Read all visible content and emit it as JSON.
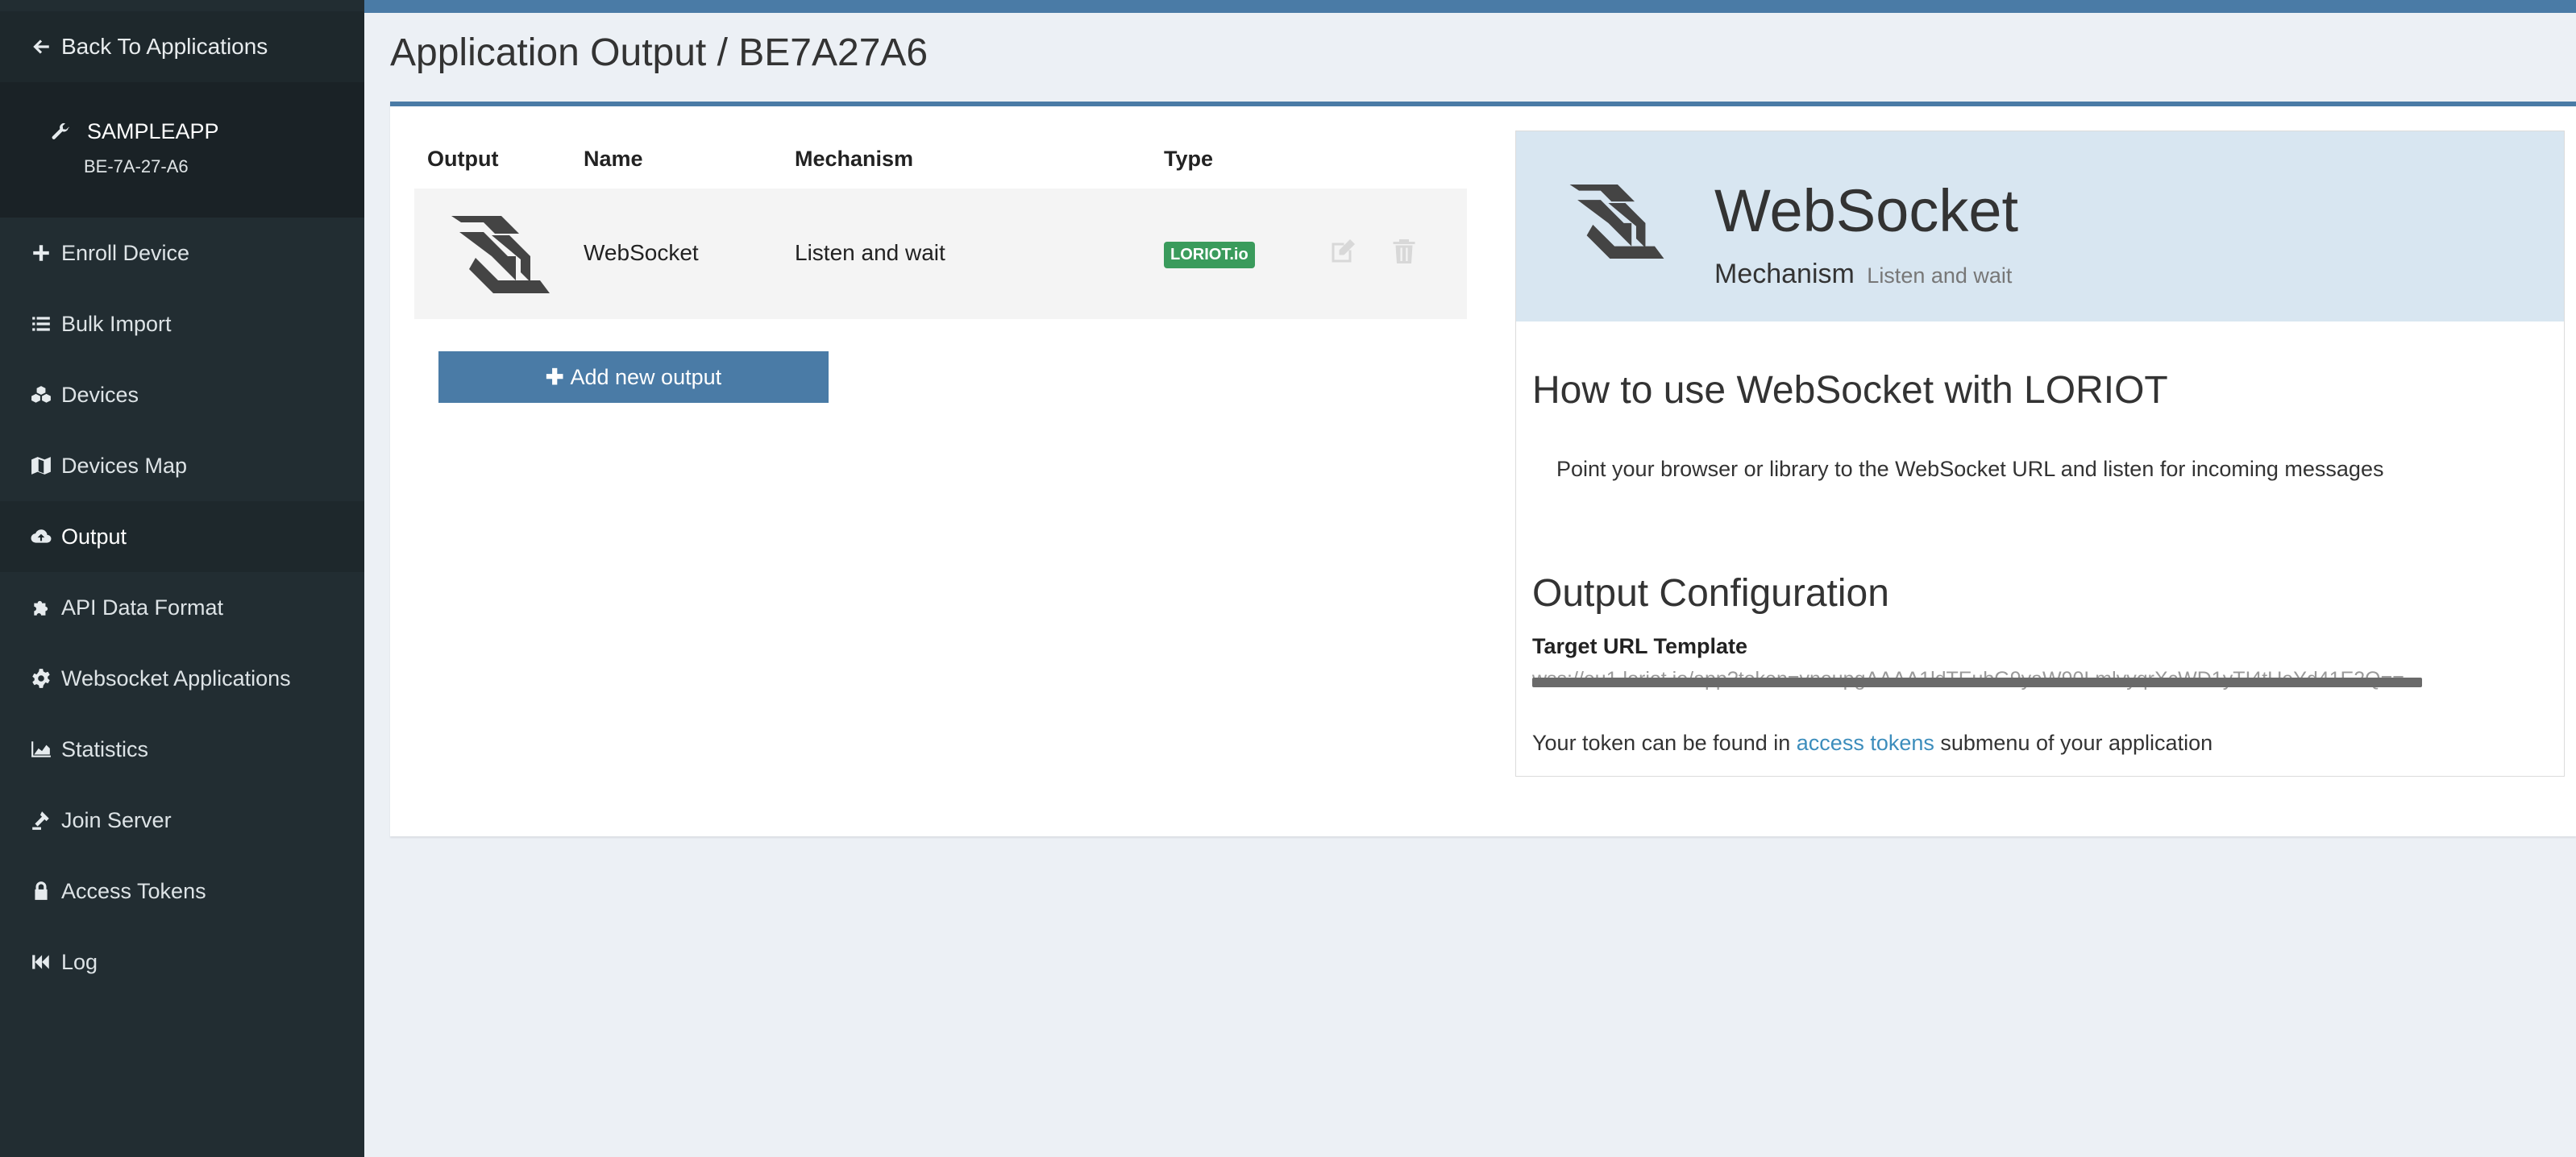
{
  "sidebar": {
    "back_label": "Back To Applications",
    "app_name": "SAMPLEAPP",
    "app_id": "BE-7A-27-A6",
    "items": [
      {
        "label": "Enroll Device",
        "icon": "plus-icon"
      },
      {
        "label": "Bulk Import",
        "icon": "list-icon"
      },
      {
        "label": "Devices",
        "icon": "cubes-icon"
      },
      {
        "label": "Devices Map",
        "icon": "map-icon"
      },
      {
        "label": "Output",
        "icon": "cloud-upload-icon"
      },
      {
        "label": "API Data Format",
        "icon": "puzzle-icon"
      },
      {
        "label": "Websocket Applications",
        "icon": "gear-icon"
      },
      {
        "label": "Statistics",
        "icon": "area-chart-icon"
      },
      {
        "label": "Join Server",
        "icon": "gavel-icon"
      },
      {
        "label": "Access Tokens",
        "icon": "lock-icon"
      },
      {
        "label": "Log",
        "icon": "fast-backward-icon"
      }
    ],
    "active": "Output"
  },
  "page": {
    "title": "Application Output / BE7A27A6"
  },
  "table": {
    "headers": [
      "Output",
      "Name",
      "Mechanism",
      "Type"
    ],
    "rows": [
      {
        "name": "WebSocket",
        "mechanism": "Listen and wait",
        "type": "LORIOT.io"
      }
    ],
    "add_button": "Add new output"
  },
  "panel": {
    "title": "WebSocket",
    "mechanism_label": "Mechanism",
    "mechanism_value": "Listen and wait",
    "howto_title": "How to use WebSocket with LORIOT",
    "howto_text": "Point your browser or library to the WebSocket URL and listen for incoming messages",
    "config_title": "Output Configuration",
    "target_label": "Target URL Template",
    "target_value": "wss://eu1.loriot.io/app?token=vnoupgAAAA1ldTEubG9yaW90LmlvyqrXcWD1yTI4tUeYd41E2Q==",
    "token_text_prefix": "Your token can be found in",
    "token_link": "access tokens",
    "token_text_suffix": "submenu of your application"
  },
  "colors": {
    "accent": "#4a7ba6",
    "sidebar_bg": "#222d32",
    "badge_green": "#3a9b5c",
    "panel_head_bg": "#d8e6f1"
  }
}
